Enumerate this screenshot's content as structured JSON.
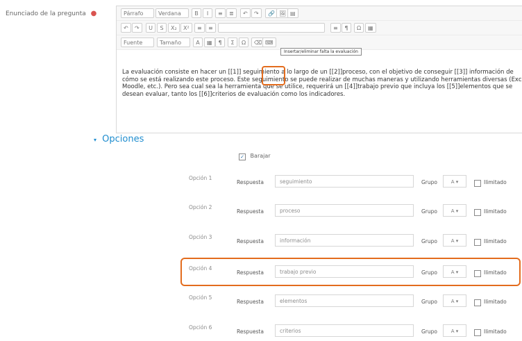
{
  "question_text": {
    "label": "Enunciado de la pregunta"
  },
  "editor": {
    "toolbar_row1": [
      "Párrafo",
      "Verdana",
      "B",
      "I",
      "≡",
      "≣",
      "↶",
      "↷",
      "🔗",
      "🖼",
      "▤"
    ],
    "toolbar_row2": [
      "↶",
      "↷",
      "U",
      "S",
      "X₂",
      "X²",
      "≡",
      "≡",
      "≡",
      "¶",
      "Ω",
      "▦"
    ],
    "toolbar_row3": [
      "Fuente",
      "Tamaño",
      "A",
      "▦",
      "¶",
      "Σ",
      "Ω",
      "⌫",
      "⌨"
    ],
    "tooltip": "Insertar/eliminar falta la evaluación",
    "paragraph": "La evaluación consiste en hacer un [[1]] seguimiento a lo largo de un [[2]]proceso, con el objetivo de conseguir [[3]] información de cómo se está realizando este proceso. Este seguimiento se puede realizar de muchas maneras y utilizando herramientas diversas (Excel, Moodle, etc.). Pero sea cual sea la herramienta que se utilice, requerirá un [[4]]trabajo previo que incluya los [[5]]elementos que se desean evaluar, tanto los [[6]]criterios de evaluación como los indicadores."
  },
  "options": {
    "title": "Opciones",
    "shuffle_label": "Barajar",
    "response_label": "Respuesta",
    "group_label": "Grupo",
    "group_value": "A",
    "unlimited_label": "Ilimitado",
    "items": [
      {
        "label": "Opción 1",
        "value": "seguimiento"
      },
      {
        "label": "Opción 2",
        "value": "proceso"
      },
      {
        "label": "Opción 3",
        "value": "información"
      },
      {
        "label": "Opción 4",
        "value": "trabajo previo"
      },
      {
        "label": "Opción 5",
        "value": "elementos"
      },
      {
        "label": "Opción 6",
        "value": "criterios"
      }
    ]
  },
  "colors": {
    "accent": "#1f8dcf",
    "highlight": "#e36c1d",
    "required": "#d9534f"
  }
}
